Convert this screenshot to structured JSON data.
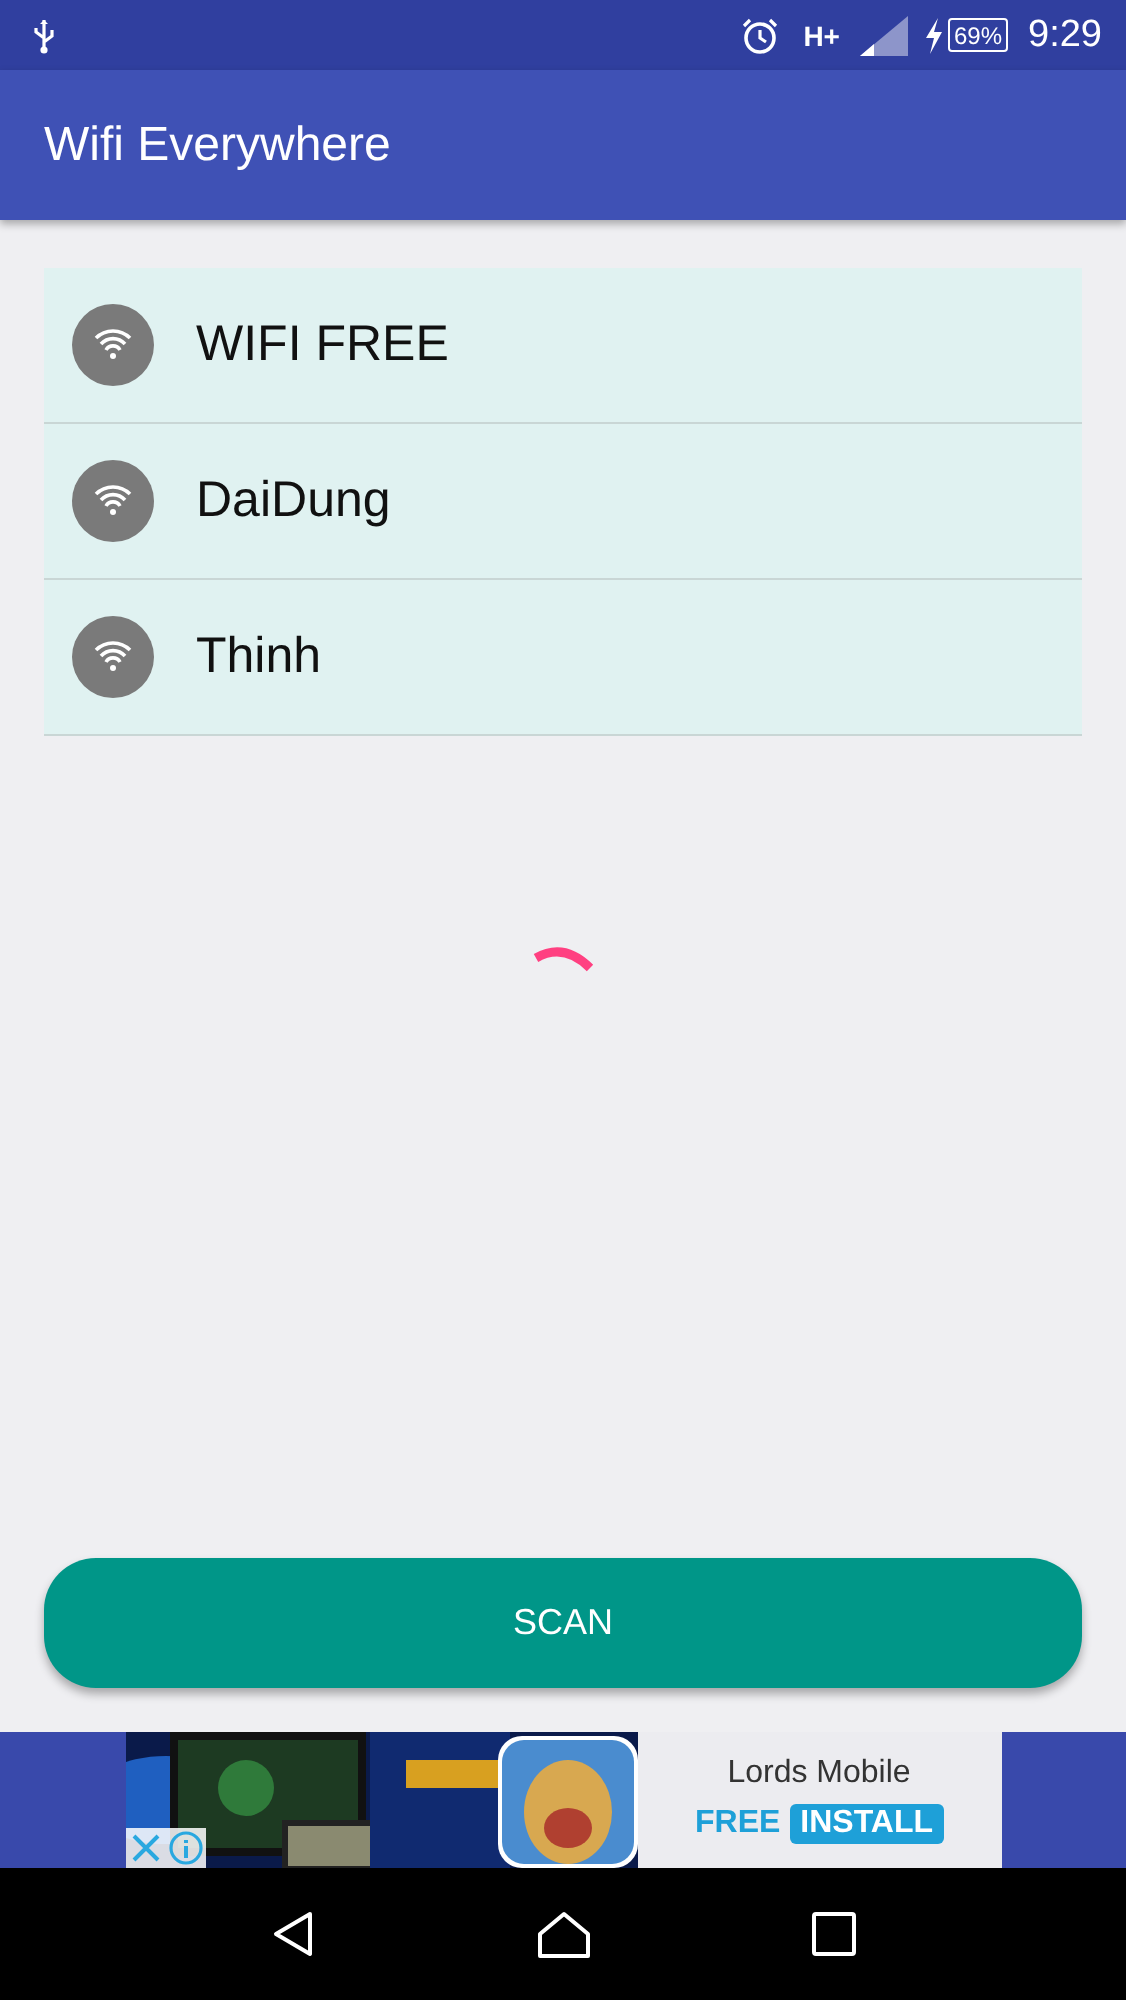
{
  "status_bar": {
    "network_type": "H+",
    "battery": "69%",
    "time": "9:29"
  },
  "app_bar": {
    "title": "Wifi Everywhere"
  },
  "networks": [
    {
      "name": "WIFI FREE"
    },
    {
      "name": "DaiDung"
    },
    {
      "name": "Thinh"
    }
  ],
  "loading": true,
  "scan_button": {
    "label": "SCAN"
  },
  "ad": {
    "kind": "picture",
    "title": "Lords Mobile",
    "price": "FREE",
    "action": "INSTALL"
  }
}
